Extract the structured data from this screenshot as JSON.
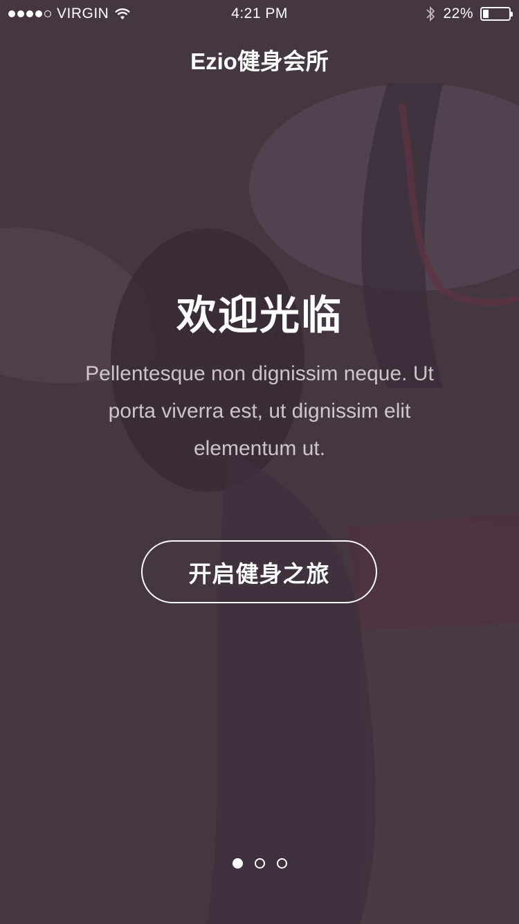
{
  "status_bar": {
    "carrier": "VIRGIN",
    "time": "4:21 PM",
    "battery_text": "22%",
    "battery_level": 0.22
  },
  "nav": {
    "title": "Ezio健身会所"
  },
  "hero": {
    "title": "欢迎光临",
    "description": "Pellentesque non dignissim neque. Ut porta viverra est, ut dignissim elit elementum ut.",
    "cta_label": "开启健身之旅"
  },
  "pager": {
    "count": 3,
    "active_index": 0
  },
  "colors": {
    "overlay": "#3c2e3a",
    "accent": "#ffffff"
  }
}
